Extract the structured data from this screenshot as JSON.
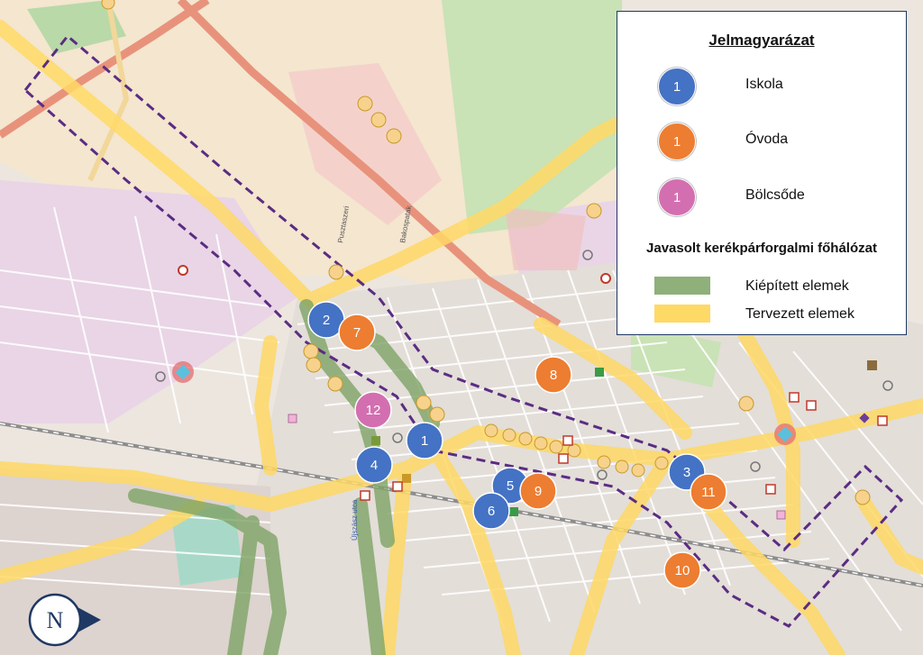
{
  "legend": {
    "title": "Jelmagyarázat",
    "school": {
      "label": "Iskola",
      "number": "1",
      "color": "#4472c4"
    },
    "kindergarten": {
      "label": "Óvoda",
      "number": "1",
      "color": "#ed7d31"
    },
    "nursery": {
      "label": "Bölcsőde",
      "number": "1",
      "color": "#d36fb0"
    },
    "network_title": "Javasolt kerékpárforgalmi főhálózat",
    "built": {
      "label": "Kiépített elemek",
      "color": "#8fb07a"
    },
    "planned": {
      "label": "Tervezett elemek",
      "color": "#ffd966"
    }
  },
  "markers": {
    "schools": [
      "1",
      "2",
      "3",
      "4",
      "5",
      "6"
    ],
    "kindergartens": [
      "7",
      "8",
      "9",
      "10",
      "11"
    ],
    "nurseries": [
      "12"
    ]
  },
  "compass": {
    "letter": "N"
  },
  "map_labels": {
    "street_ujszasz": "Újszász utca",
    "street_bakospatak": "Bakospatak",
    "street_pusztaszeri": "Pusztaszeri"
  },
  "colors": {
    "background": "#ece6df",
    "residential": "#e3d8d4",
    "industrial": "#e9d5e6",
    "farmland": "#f4e6cf",
    "green": "#b9d9a8",
    "road_major": "#e8927c",
    "road_yellow": "#f2d79a",
    "rail": "#8d8d8d",
    "boundary": "#5b2c83",
    "school": "#4472c4",
    "kindergarten": "#ed7d31",
    "nursery": "#d36fb0"
  }
}
